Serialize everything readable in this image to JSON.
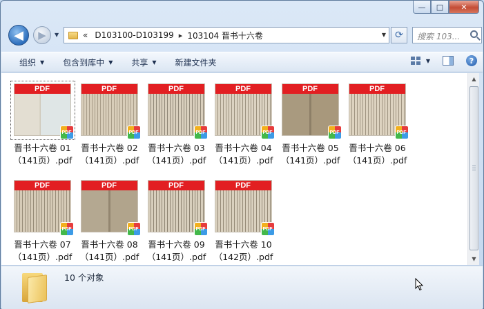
{
  "window": {
    "caption": {
      "minimize": "—",
      "maximize": "□",
      "close": "✕"
    }
  },
  "nav": {
    "back_glyph": "◀",
    "forward_glyph": "▶",
    "dropdown_glyph": "▼",
    "breadcrumb": {
      "chevrons": "«",
      "parent": "D103100-D103199",
      "sep": "▸",
      "current": "103104 晋书十六卷"
    },
    "refresh_glyph": "⟳",
    "search_placeholder": "搜索 103..."
  },
  "toolbar": {
    "organize": "组织",
    "include_in_library": "包含到库中",
    "share": "共享",
    "new_folder": "新建文件夹",
    "arrow": "▼",
    "help": "?"
  },
  "files": [
    {
      "name": "晋书十六卷 01",
      "pages": "（141页）.pdf",
      "selected": true
    },
    {
      "name": "晋书十六卷 02",
      "pages": "（141页）.pdf"
    },
    {
      "name": "晋书十六卷 03",
      "pages": "（141页）.pdf"
    },
    {
      "name": "晋书十六卷 04",
      "pages": "（141页）.pdf"
    },
    {
      "name": "晋书十六卷 05",
      "pages": "（141页）.pdf"
    },
    {
      "name": "晋书十六卷 06",
      "pages": "（141页）.pdf"
    },
    {
      "name": "晋书十六卷 07",
      "pages": "（141页）.pdf"
    },
    {
      "name": "晋书十六卷 08",
      "pages": "（141页）.pdf"
    },
    {
      "name": "晋书十六卷 09",
      "pages": "（141页）.pdf"
    },
    {
      "name": "晋书十六卷 10",
      "pages": "（142页）.pdf"
    }
  ],
  "pdf_band_label": "PDF",
  "pdf_badge_label": "PDF",
  "status": {
    "count": "10 个对象"
  },
  "scrollbar": {
    "up": "▲",
    "down": "▼"
  },
  "colors": {
    "pdf_red": "#e21f22",
    "window_chrome": "#c2d6ee",
    "content_bg": "#ffffff"
  }
}
